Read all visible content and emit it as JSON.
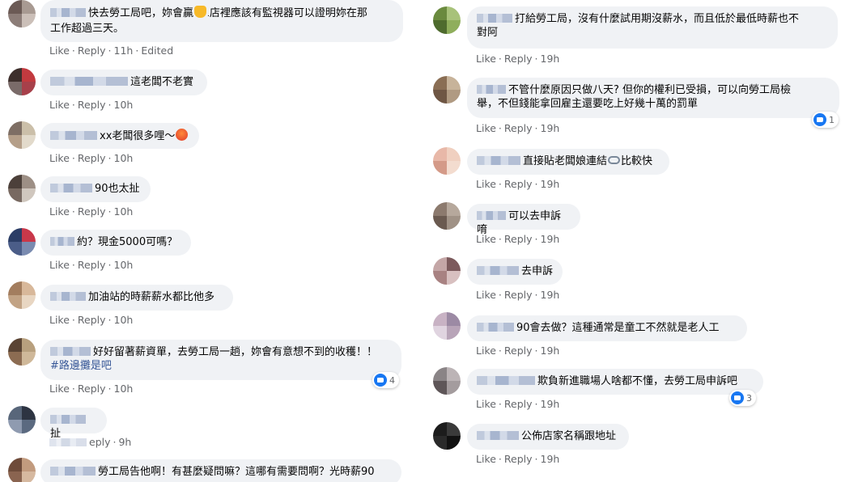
{
  "actions": {
    "like": "Like",
    "reply": "Reply",
    "sep": "·",
    "edited": "Edited"
  },
  "left": [
    {
      "text": "快去勞工局吧，妳會贏",
      "text2": "店裡應該有監視器可以證明妳在那",
      "text3": "工作超過三天。",
      "time": "11h",
      "edited": true
    },
    {
      "text": "這老闆不老實",
      "time": "10h"
    },
    {
      "text": "xx老闆很多哩～",
      "time": "10h"
    },
    {
      "text": "90也太扯",
      "time": "10h"
    },
    {
      "text": "約？現金5000可嗎？",
      "time": "10h"
    },
    {
      "text": "加油站的時薪薪水都比他多",
      "time": "10h"
    },
    {
      "text": "好好留著薪資單，去勞工局一趟，妳會有意想不到的收穫！！",
      "hashtag": "#路邊攤是吧",
      "time": "10h",
      "reactions": "4"
    },
    {
      "text": "扯",
      "time": "9h",
      "reply_partial": "eply"
    },
    {
      "text": "勞工局告他啊！有甚麼疑問嘛？這哪有需要問啊？光時薪90"
    }
  ],
  "right": [
    {
      "text": "打給勞工局，沒有什麼試用期沒薪水，而且低於最低時薪也不",
      "text2": "對阿",
      "time": "19h"
    },
    {
      "text": "不管什麼原因只做八天? 但你的權利已受損，可以向勞工局檢",
      "text2": "舉，不但錢能拿回雇主還要吃上好幾十萬的罰單",
      "time": "19h",
      "reactions": "1"
    },
    {
      "text": "直接貼老闆娘連結",
      "text_after": "比較快",
      "time": "19h"
    },
    {
      "text": "可以去申訴唷",
      "time": "19h"
    },
    {
      "text": "去申訴",
      "time": "19h"
    },
    {
      "text": "90會去做？這種通常是童工不然就是老人工",
      "time": "19h"
    },
    {
      "text": "欺負新進職場人啥都不懂，去勞工局申訴吧",
      "time": "19h",
      "reactions": "3"
    },
    {
      "text": "公佈店家名稱跟地址",
      "time": "19h"
    }
  ]
}
